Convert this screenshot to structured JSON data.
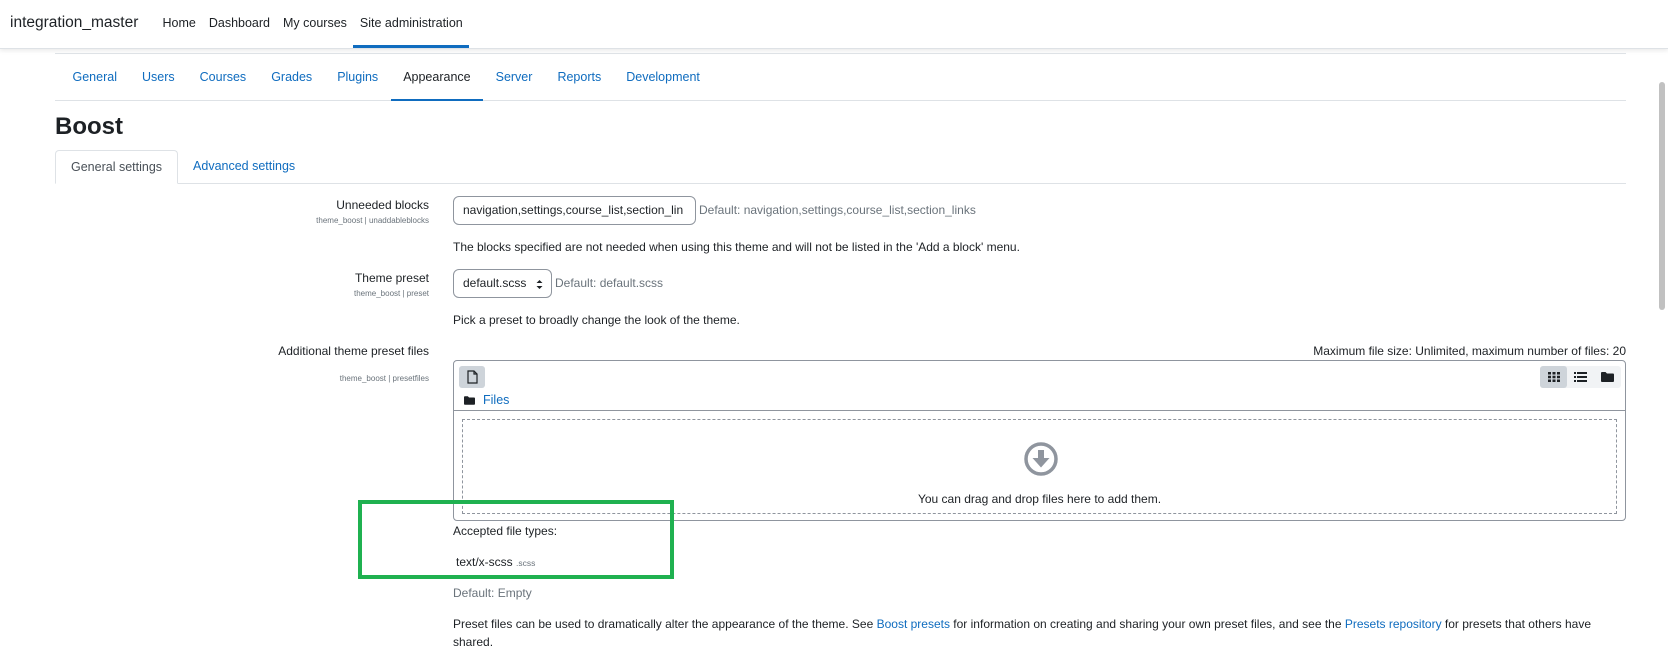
{
  "navbar": {
    "brand": "integration_master",
    "items": [
      {
        "label": "Home"
      },
      {
        "label": "Dashboard"
      },
      {
        "label": "My courses"
      },
      {
        "label": "Site administration"
      }
    ]
  },
  "secondary_nav": {
    "items": [
      {
        "label": "General"
      },
      {
        "label": "Users"
      },
      {
        "label": "Courses"
      },
      {
        "label": "Grades"
      },
      {
        "label": "Plugins"
      },
      {
        "label": "Appearance"
      },
      {
        "label": "Server"
      },
      {
        "label": "Reports"
      },
      {
        "label": "Development"
      }
    ],
    "active": "Appearance"
  },
  "page": {
    "title": "Boost",
    "tabs": [
      {
        "label": "General settings"
      },
      {
        "label": "Advanced settings"
      }
    ]
  },
  "settings": {
    "unneeded_blocks": {
      "label": "Unneeded blocks",
      "id": "theme_boost | unaddableblocks",
      "value": "navigation,settings,course_list,section_lin",
      "default": "Default: navigation,settings,course_list,section_links",
      "description": "The blocks specified are not needed when using this theme and will not be listed in the 'Add a block' menu."
    },
    "theme_preset": {
      "label": "Theme preset",
      "id": "theme_boost | preset",
      "value": "default.scss",
      "default": "Default: default.scss",
      "description": "Pick a preset to broadly change the look of the theme."
    },
    "preset_files": {
      "label": "Additional theme preset files",
      "id": "theme_boost | presetfiles",
      "max_size": "Maximum file size: Unlimited, maximum number of files: 20",
      "path_label": "Files",
      "drop_text": "You can drag and drop files here to add them.",
      "accepted_label": "Accepted file types:",
      "accepted_type": "text/x-scss",
      "accepted_ext": ".scss",
      "default": "Default: Empty",
      "desc_part1": "Preset files can be used to dramatically alter the appearance of the theme. See ",
      "desc_link1": "Boost presets",
      "desc_part2": " for information on creating and sharing your own preset files, and see the ",
      "desc_link2": "Presets repository",
      "desc_part3": " for presets that others have shared."
    }
  },
  "colors": {
    "link": "#0f6cbf",
    "highlight": "#1fb150"
  }
}
